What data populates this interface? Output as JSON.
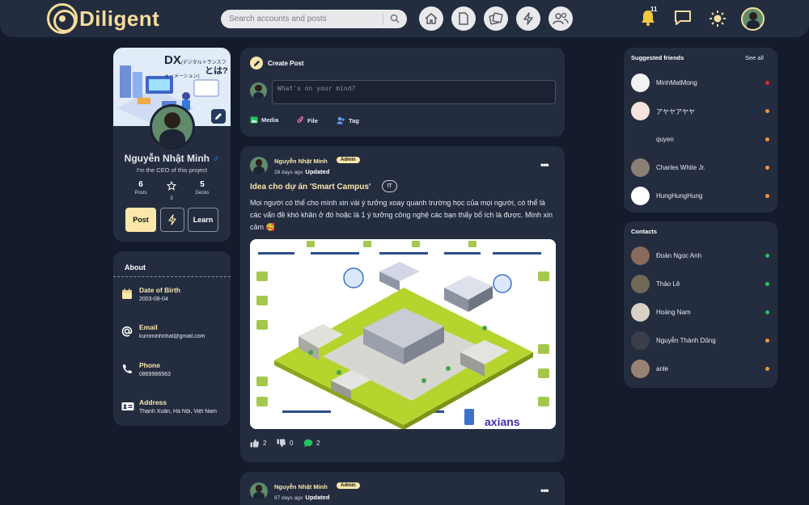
{
  "app": {
    "name": "Diligent"
  },
  "header": {
    "search_placeholder": "Search accounts and posts",
    "nav": [
      "home-icon",
      "document-icon",
      "decks-icon",
      "bolt-icon",
      "people-icon"
    ],
    "notification_count": "11"
  },
  "profile": {
    "cover_title": "DX",
    "cover_sub": "(デジタルトランスフォーメーション)",
    "cover_suffix": "とは?",
    "name": "Nguyễn Nhật Minh",
    "gender_symbol": "♂",
    "bio": "I'm the CEO of this project",
    "stats": [
      {
        "value": "6",
        "label": "Posts"
      },
      {
        "value": "",
        "label": "3"
      },
      {
        "value": "5",
        "label": "Decks"
      }
    ],
    "buttons": {
      "post": "Post",
      "learn": "Learn"
    }
  },
  "about": {
    "title": "About",
    "items": [
      {
        "label": "Date of Birth",
        "value": "2003-08-04",
        "icon": "calendar-icon"
      },
      {
        "label": "Email",
        "value": "kurominhnhat@gmail.com",
        "icon": "at-icon"
      },
      {
        "label": "Phone",
        "value": "0869986563",
        "icon": "phone-icon"
      },
      {
        "label": "Address",
        "value": "Thanh Xuân, Hà Nội, Việt Nam",
        "icon": "id-card-icon"
      }
    ]
  },
  "create_post": {
    "title": "Create Post",
    "placeholder": "What's on your mind?",
    "actions": {
      "media": "Media",
      "file": "File",
      "tag": "Tag"
    }
  },
  "posts": [
    {
      "author": "Nguyễn Nhật Minh",
      "role": "Admin",
      "time": "28 days ago",
      "status": "Updated",
      "title": "Idea cho dự án 'Smart Campus'",
      "tag": "IT",
      "body": "Mọi người có thể cho mình xin vài ý tưởng xoay quanh trường học của mọi người, có thể là các vấn đề khó khăn ở đó hoặc là 1 ý tưởng công nghệ các bạn thấy bổ ích là được. Mình xin cảm 🥰",
      "image_brand": "axians",
      "likes": "2",
      "dislikes": "0",
      "comments": "2"
    },
    {
      "author": "Nguyễn Nhật Minh",
      "role": "Admin",
      "time": "87 days ago",
      "status": "Updated"
    }
  ],
  "suggested": {
    "title": "Suggested friends",
    "see_all": "See all",
    "items": [
      {
        "name": "MinhMatMong",
        "status_color": "#e02424",
        "avatar_bg": "#f2f2f2"
      },
      {
        "name": "アヤヤアヤヤ",
        "status_color": "#f5913a",
        "avatar_bg": "#f4e4dc"
      },
      {
        "name": "quyen",
        "status_color": "#f5913a",
        "avatar_bg": "#242d40"
      },
      {
        "name": "Charles White Jr.",
        "status_color": "#f5913a",
        "avatar_bg": "#8b7f74"
      },
      {
        "name": "HungHungHung",
        "status_color": "#f5913a",
        "avatar_bg": "#ffffff"
      }
    ]
  },
  "contacts": {
    "title": "Contacts",
    "items": [
      {
        "name": "Đoàn Ngọc Anh",
        "status_color": "#22c55e",
        "avatar_bg": "#8a6a5a"
      },
      {
        "name": "Thảo Lê",
        "status_color": "#22c55e",
        "avatar_bg": "#6e6a55"
      },
      {
        "name": "Hoàng Nam",
        "status_color": "#22c55e",
        "avatar_bg": "#d9d2c4"
      },
      {
        "name": "Nguyễn Thành Dũng",
        "status_color": "#f5913a",
        "avatar_bg": "#3a3f4a"
      },
      {
        "name": "anle",
        "status_color": "#f5913a",
        "avatar_bg": "#9a8272"
      }
    ]
  }
}
